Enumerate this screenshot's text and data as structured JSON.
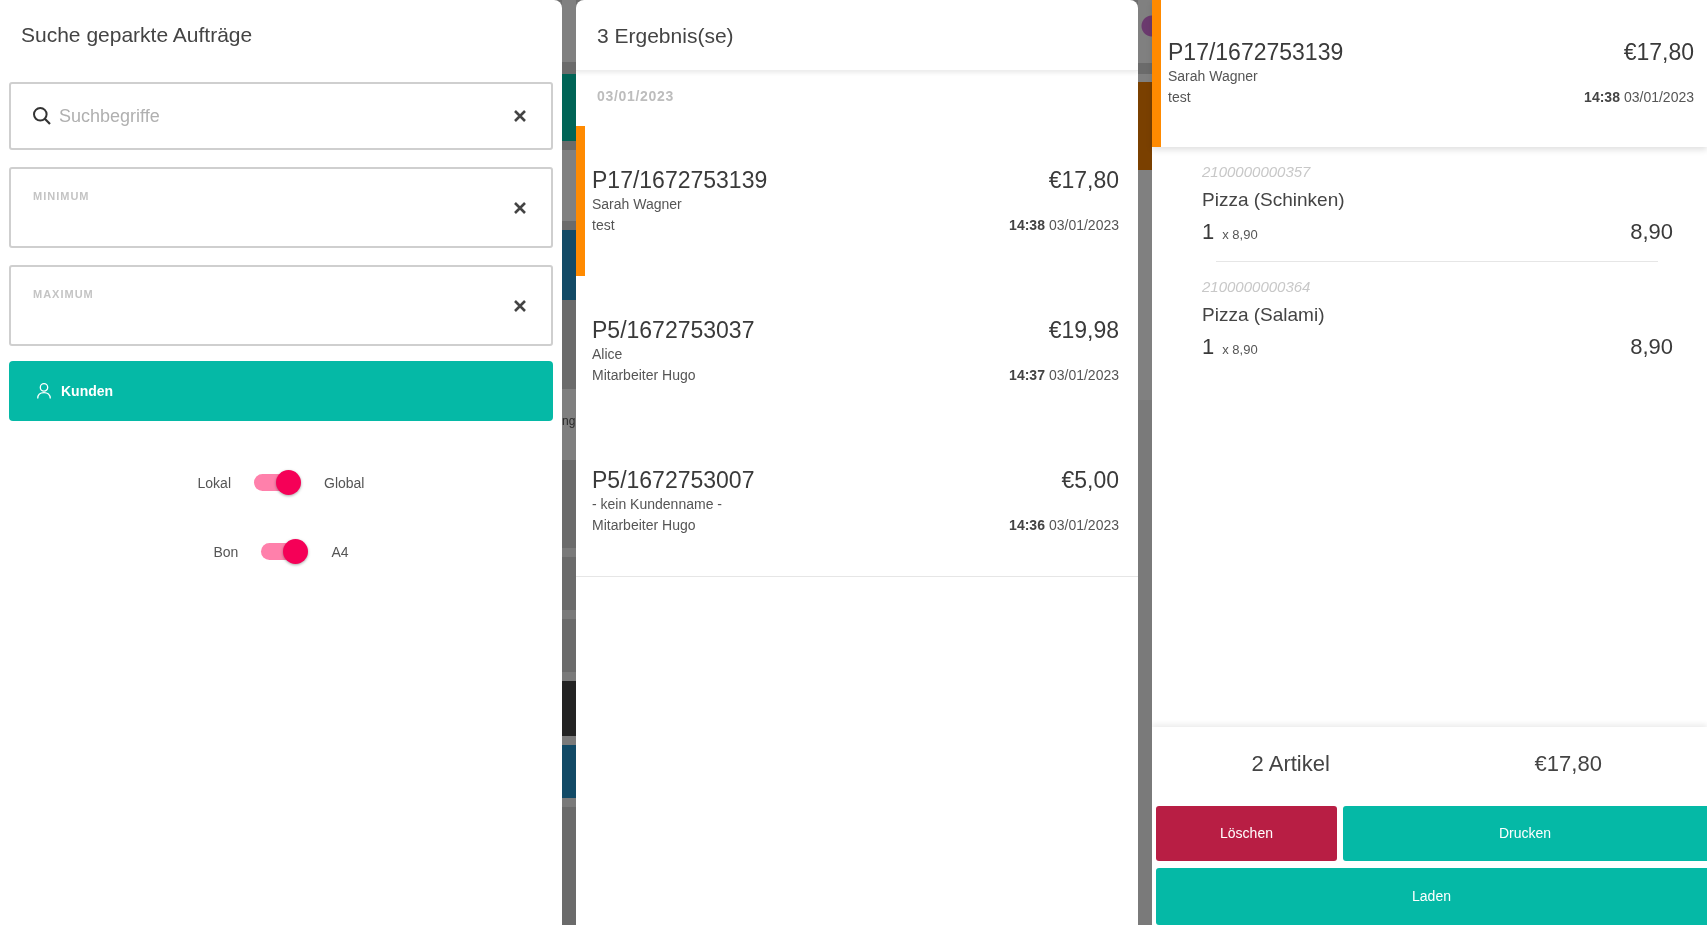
{
  "search_panel": {
    "title": "Suche geparkte Aufträge",
    "fields": [
      {
        "kind": "search",
        "placeholder": "Suchbegriffe"
      },
      {
        "kind": "labeled",
        "label": "MINIMUM"
      },
      {
        "kind": "labeled",
        "label": "MAXIMUM"
      }
    ],
    "customers_button": {
      "label": "Kunden"
    },
    "toggles": [
      {
        "left_label": "Lokal",
        "right_label": "Global",
        "on": true
      },
      {
        "left_label": "Bon",
        "right_label": "A4",
        "on": true
      }
    ]
  },
  "results_panel": {
    "title": "3 Ergebnis(se)",
    "groups": [
      {
        "date": "03/01/2023",
        "orders": [
          {
            "number": "P17/1672753139",
            "total": "€17,80",
            "customer": "Sarah Wagner",
            "note": "test",
            "time": "14:38",
            "date": "03/01/2023",
            "selected": true
          },
          {
            "number": "P5/1672753037",
            "total": "€19,98",
            "customer": "Alice",
            "note": "Mitarbeiter Hugo",
            "time": "14:37",
            "date": "03/01/2023",
            "selected": false
          },
          {
            "number": "P5/1672753007",
            "total": "€5,00",
            "customer": "- kein Kundenname -",
            "note": "Mitarbeiter Hugo",
            "time": "14:36",
            "date": "03/01/2023",
            "selected": false
          }
        ]
      }
    ]
  },
  "order_detail": {
    "order": {
      "number": "P17/1672753139",
      "total": "€17,80",
      "customer": "Sarah Wagner",
      "note": "test",
      "time": "14:38",
      "date": "03/01/2023"
    },
    "items": [
      {
        "code": "2100000000357",
        "name": "Pizza (Schinken)",
        "quantity": "1",
        "unit_price": "x 8,90",
        "amount": "8,90"
      },
      {
        "code": "2100000000364",
        "name": "Pizza (Salami)",
        "quantity": "1",
        "unit_price": "x 8,90",
        "amount": "8,90"
      }
    ],
    "summary": {
      "count": "2 Artikel",
      "total": "€17,80"
    },
    "button_rows": [
      {
        "buttons": [
          {
            "kind": "danger",
            "label": "Löschen"
          },
          {
            "kind": "primary",
            "label": "Drucken"
          }
        ]
      },
      {
        "buttons": [
          {
            "kind": "primary",
            "label": "Laden"
          }
        ]
      }
    ]
  },
  "background": {
    "text_fragment": "ng"
  }
}
